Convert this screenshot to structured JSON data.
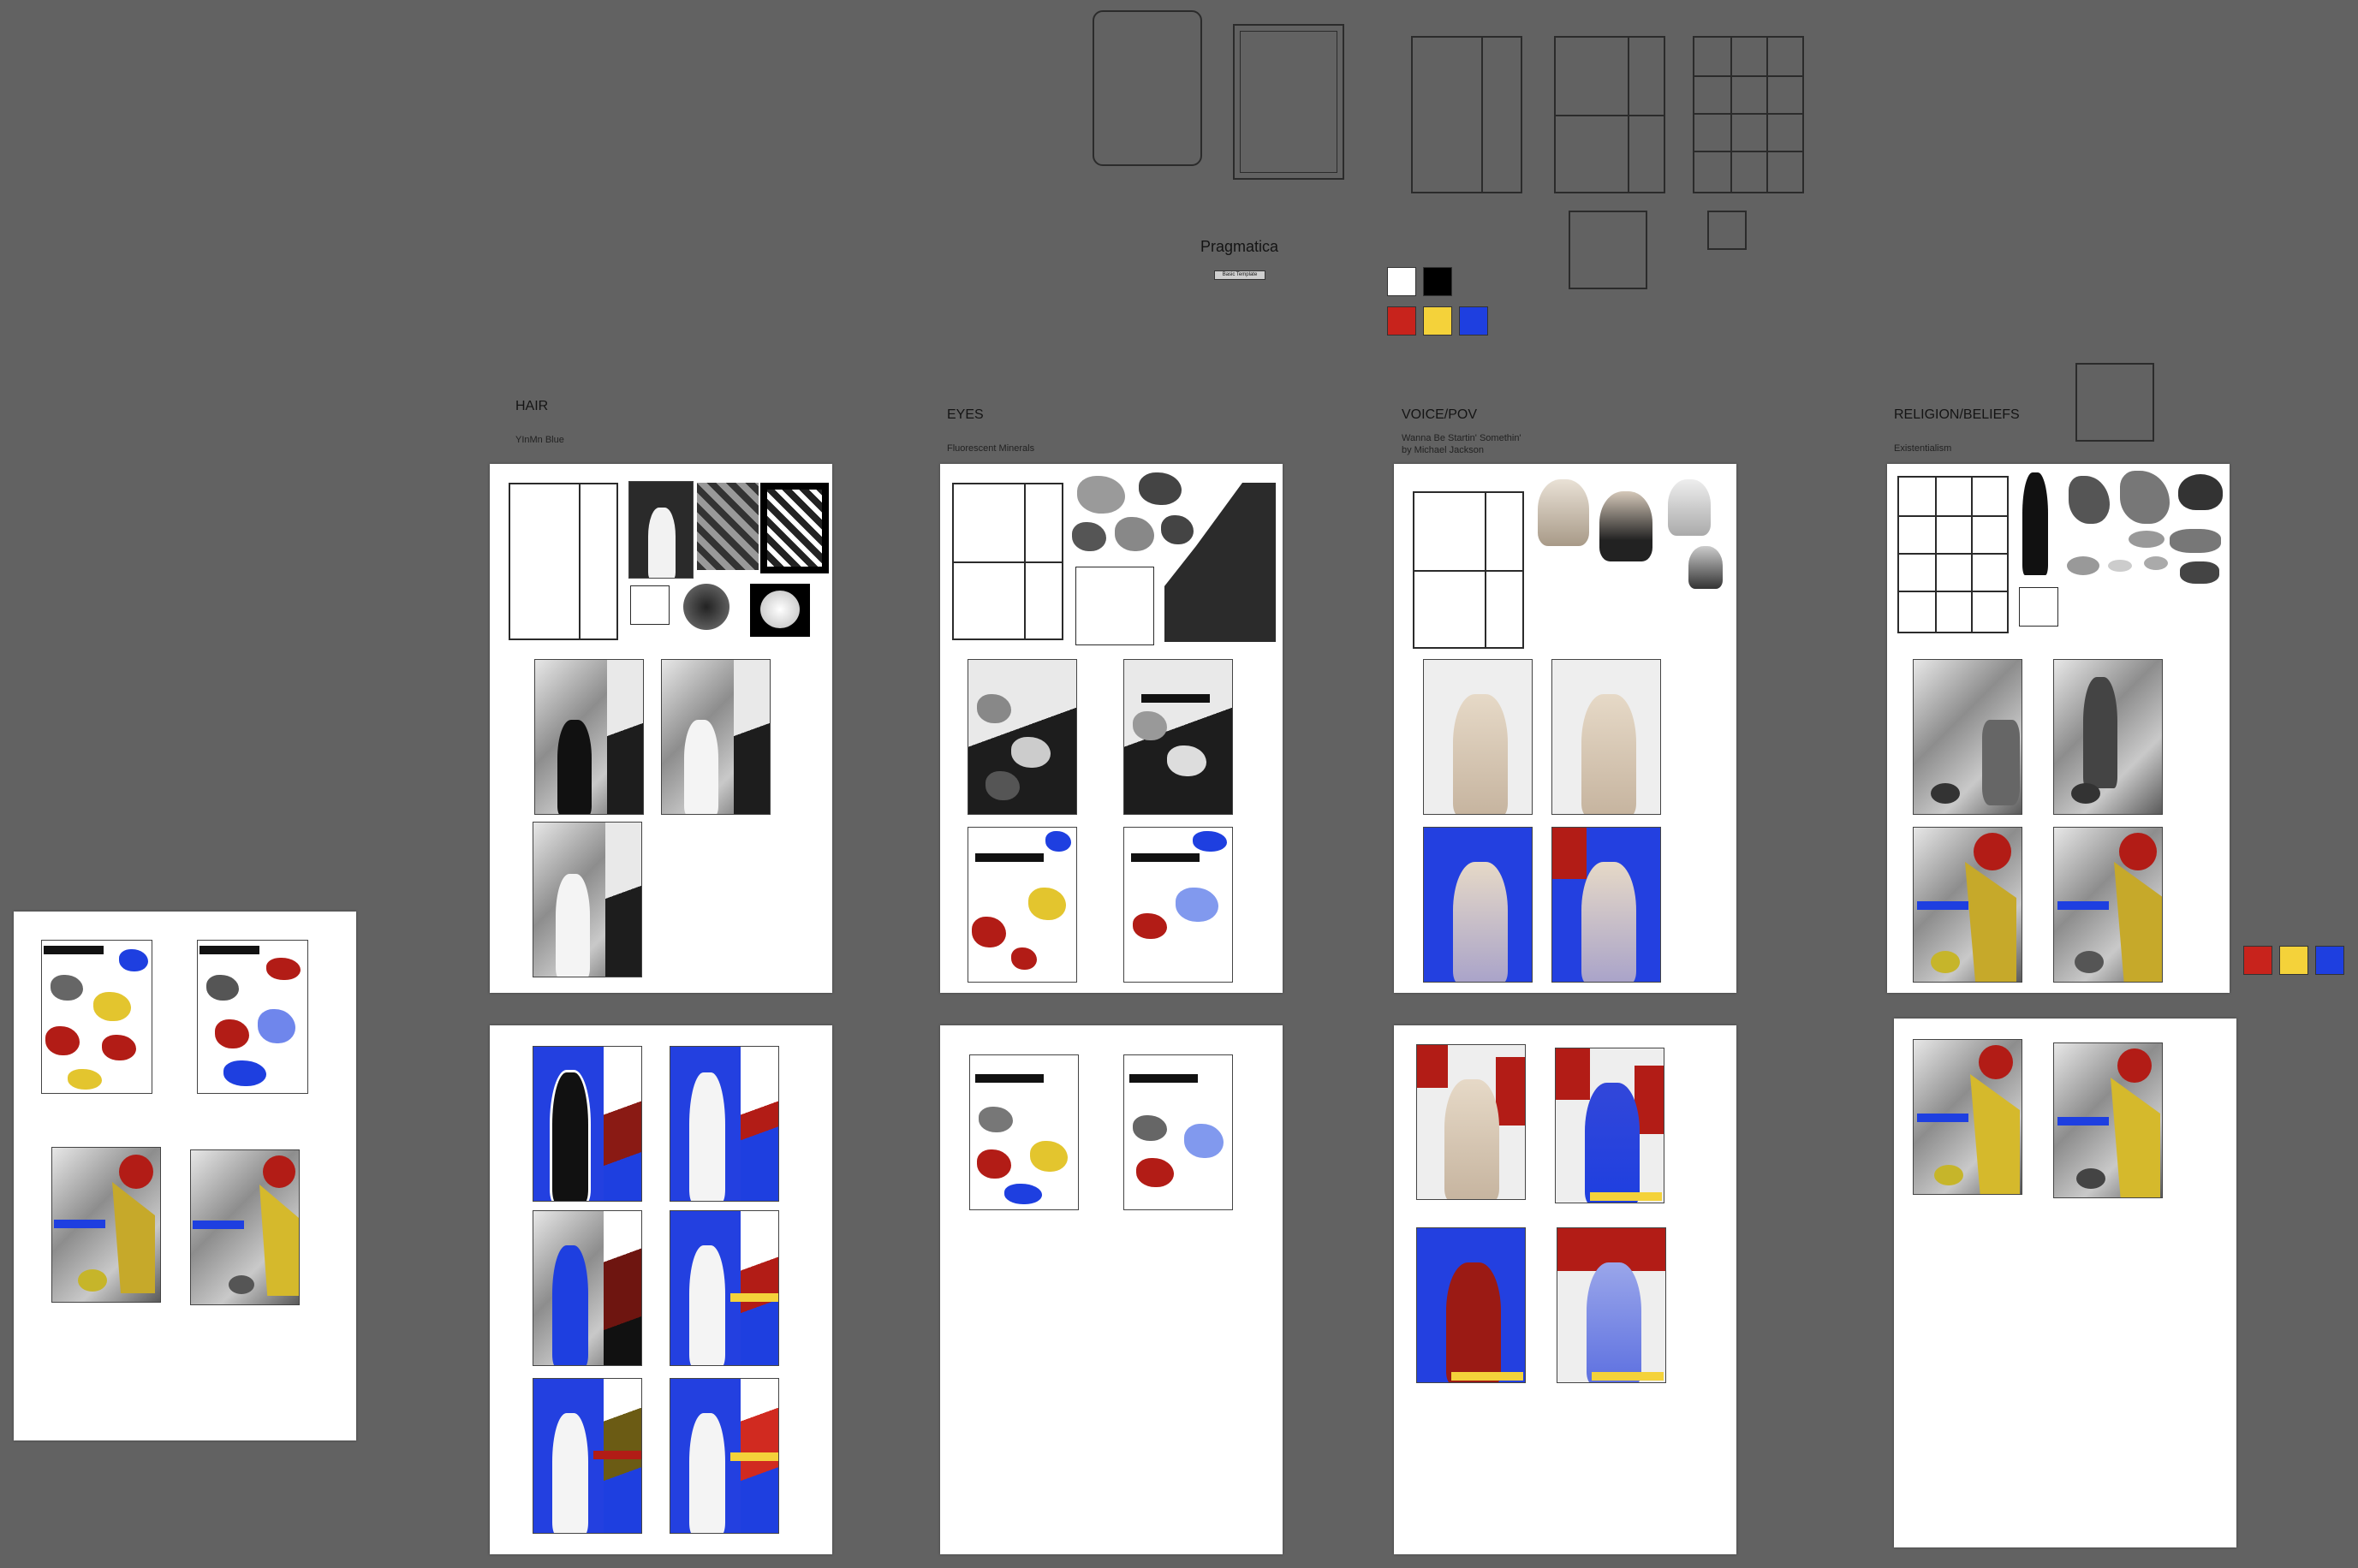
{
  "header": {
    "title": "Pragmatica",
    "button_label": "Basic Template"
  },
  "palette": {
    "top": [
      "#ffffff",
      "#000000"
    ],
    "primary": [
      "#c8231c",
      "#f4d23a",
      "#1e3fe0"
    ],
    "side": [
      "#c8231c",
      "#f4d23a",
      "#1e3fe0"
    ]
  },
  "sections": [
    {
      "title": "HAIR",
      "subtitle": "YInMn Blue",
      "subtitle2": ""
    },
    {
      "title": "EYES",
      "subtitle": "Fluorescent Minerals",
      "subtitle2": ""
    },
    {
      "title": "VOICE/POV",
      "subtitle": "Wanna Be Startin' Somethin'",
      "subtitle2": "by Michael Jackson"
    },
    {
      "title": "RELIGION/BELIEFS",
      "subtitle": "Existentialism",
      "subtitle2": ""
    }
  ],
  "icons": {
    "figure": "silhouette-icon",
    "rock": "mineral-icon"
  }
}
